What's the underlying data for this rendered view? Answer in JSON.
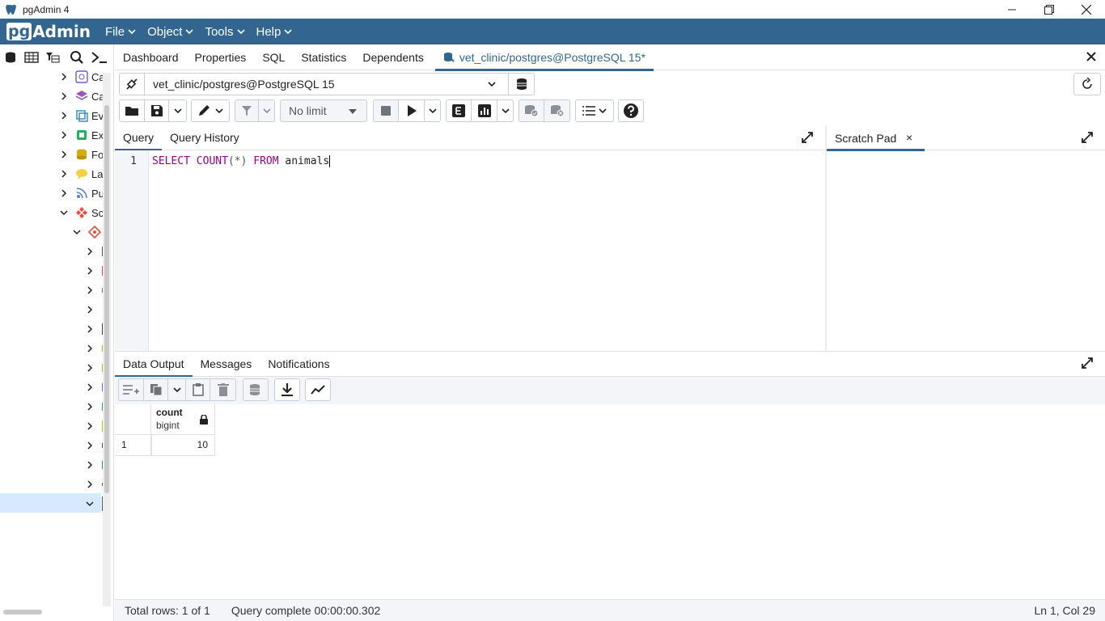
{
  "window": {
    "title": "pgAdmin 4"
  },
  "menubar": {
    "logo_pg": "pg",
    "logo_admin": "Admin",
    "items": [
      {
        "label": "File"
      },
      {
        "label": "Object"
      },
      {
        "label": "Tools"
      },
      {
        "label": "Help"
      }
    ]
  },
  "tree": {
    "items": [
      {
        "label": "Ca",
        "icon": "cast-icon"
      },
      {
        "label": "Ca",
        "icon": "catalog-icon"
      },
      {
        "label": "Ev",
        "icon": "event-trigger-icon"
      },
      {
        "label": "Ex",
        "icon": "extension-icon"
      },
      {
        "label": "Fo",
        "icon": "foreign-data-wrapper-icon"
      },
      {
        "label": "La",
        "icon": "language-icon"
      },
      {
        "label": "Pu",
        "icon": "publication-icon"
      },
      {
        "label": "Sc",
        "icon": "schemas-icon"
      }
    ]
  },
  "tabs": [
    {
      "label": "Dashboard"
    },
    {
      "label": "Properties"
    },
    {
      "label": "SQL"
    },
    {
      "label": "Statistics"
    },
    {
      "label": "Dependents"
    },
    {
      "label": "vet_clinic/postgres@PostgreSQL 15*"
    }
  ],
  "connection": {
    "value": "vet_clinic/postgres@PostgreSQL 15"
  },
  "query_toolbar": {
    "limit": "No limit"
  },
  "query_tabs": [
    {
      "label": "Query"
    },
    {
      "label": "Query History"
    }
  ],
  "editor": {
    "line_number": "1",
    "kw_select": "SELECT",
    "kw_count": "COUNT",
    "paren": "(*)",
    "kw_from": "FROM",
    "table": "animals"
  },
  "scratch": {
    "label": "Scratch Pad",
    "close": "×"
  },
  "output_tabs": [
    {
      "label": "Data Output"
    },
    {
      "label": "Messages"
    },
    {
      "label": "Notifications"
    }
  ],
  "grid": {
    "column_name": "count",
    "column_type": "bigint",
    "rows": [
      {
        "row_num": "1",
        "value": "10"
      }
    ]
  },
  "status": {
    "total_rows": "Total rows: 1 of 1",
    "query_complete": "Query complete 00:00:00.302",
    "cursor": "Ln 1, Col 29"
  },
  "colors": {
    "brand": "#326690",
    "keyword": "#990088"
  }
}
